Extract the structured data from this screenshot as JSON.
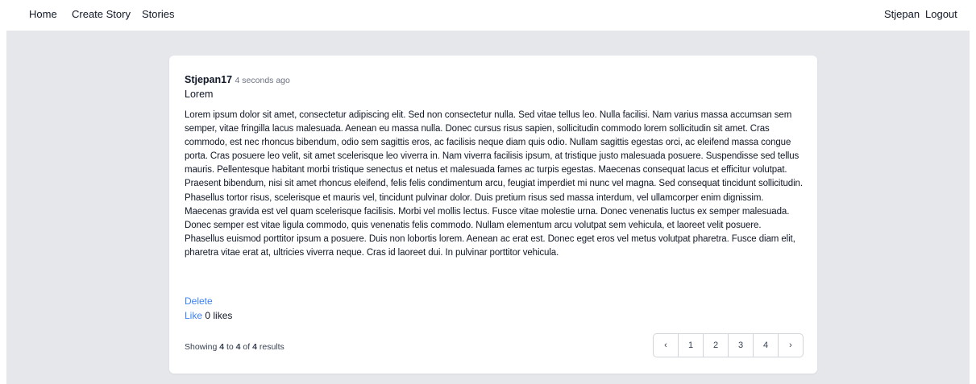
{
  "nav": {
    "home": "Home",
    "create_story": "Create Story",
    "stories": "Stories",
    "user": "Stjepan",
    "logout": "Logout"
  },
  "post": {
    "author": "Stjepan17",
    "time": "4 seconds ago",
    "title": "Lorem",
    "body": "Lorem ipsum dolor sit amet, consectetur adipiscing elit. Sed non consectetur nulla. Sed vitae tellus leo. Nulla facilisi. Nam varius massa accumsan sem semper, vitae fringilla lacus malesuada. Aenean eu massa nulla. Donec cursus risus sapien, sollicitudin commodo lorem sollicitudin sit amet. Cras commodo, est nec rhoncus bibendum, odio sem sagittis eros, ac facilisis neque diam quis odio. Nullam sagittis egestas orci, ac eleifend massa congue porta. Cras posuere leo velit, sit amet scelerisque leo viverra in. Nam viverra facilisis ipsum, at tristique justo malesuada posuere. Suspendisse sed tellus mauris. Pellentesque habitant morbi tristique senectus et netus et malesuada fames ac turpis egestas. Maecenas consequat lacus et efficitur volutpat. Praesent bibendum, nisi sit amet rhoncus eleifend, felis felis condimentum arcu, feugiat imperdiet mi nunc vel magna. Sed consequat tincidunt sollicitudin. Phasellus tortor risus, scelerisque et mauris vel, tincidunt pulvinar dolor. Duis pretium risus sed massa interdum, vel ullamcorper enim dignissim. Maecenas gravida est vel quam scelerisque facilisis. Morbi vel mollis lectus. Fusce vitae molestie urna. Donec venenatis luctus ex semper malesuada. Donec semper est vitae ligula commodo, quis venenatis felis commodo. Nullam elementum arcu volutpat sem vehicula, et laoreet velit posuere. Phasellus euismod porttitor ipsum a posuere. Duis non lobortis lorem. Aenean ac erat est. Donec eget eros vel metus volutpat pharetra. Fusce diam elit, pharetra vitae erat at, ultricies viverra neque. Cras id laoreet dui. In pulvinar porttitor vehicula.",
    "delete_label": "Delete",
    "like_label": "Like",
    "likes_count": "0",
    "likes_suffix": "likes"
  },
  "pagination": {
    "showing_prefix": "Showing",
    "from": "4",
    "to_word": "to",
    "to": "4",
    "of_word": "of",
    "total": "4",
    "results_word": "results",
    "prev_icon": "chevron-left-icon",
    "next_icon": "chevron-right-icon",
    "prev_glyph": "‹",
    "next_glyph": "›",
    "pages": [
      "1",
      "2",
      "3",
      "4"
    ]
  },
  "colors": {
    "link": "#3b82f6",
    "background": "#e5e7eb",
    "card": "#ffffff"
  }
}
